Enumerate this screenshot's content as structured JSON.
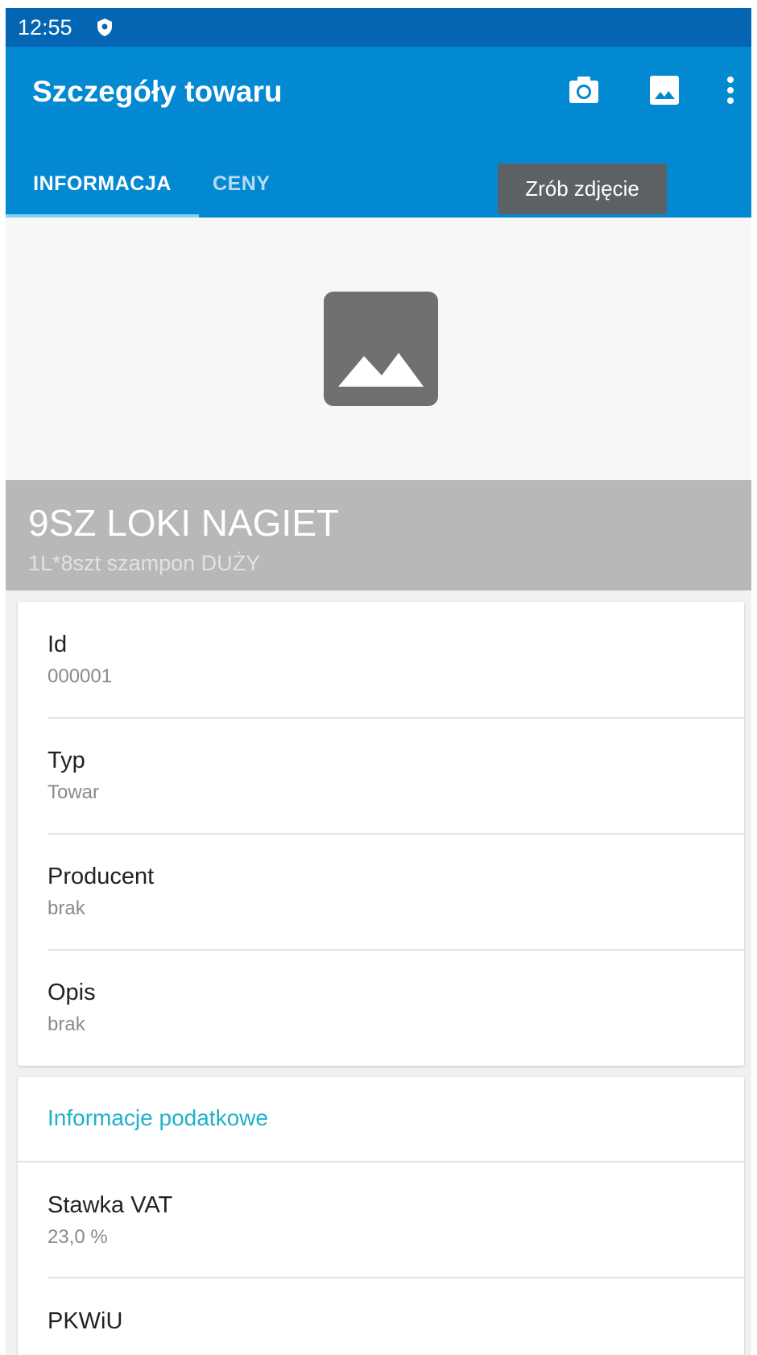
{
  "status_bar": {
    "time": "12:55",
    "shield_icon": "shield-icon"
  },
  "app_bar": {
    "title": "Szczegóły towaru",
    "actions": [
      {
        "icon": "camera-icon"
      },
      {
        "icon": "image-icon"
      },
      {
        "icon": "more-vert-icon"
      }
    ],
    "tooltip": "Zrób zdjęcie"
  },
  "tabs": [
    {
      "label": "INFORMACJA",
      "active": true
    },
    {
      "label": "CENY",
      "active": false
    }
  ],
  "image_placeholder": {
    "icon": "image-placeholder-icon"
  },
  "product": {
    "name": "9SZ LOKI NAGIET",
    "description": "1L*8szt szampon DUŻY"
  },
  "details": [
    {
      "label": "Id",
      "value": "000001"
    },
    {
      "label": "Typ",
      "value": "Towar"
    },
    {
      "label": "Producent",
      "value": "brak"
    },
    {
      "label": "Opis",
      "value": "brak"
    }
  ],
  "tax_section": {
    "title": "Informacje podatkowe",
    "fields": [
      {
        "label": "Stawka VAT",
        "value": "23,0 %"
      },
      {
        "label": "PKWiU"
      }
    ]
  },
  "colors": {
    "status_bar": "#0465b2",
    "app_bar": "#0388d2",
    "tab_indicator": "#7fd3ee",
    "section_title": "#1fb1c9",
    "product_header": "#b8b8b8"
  }
}
